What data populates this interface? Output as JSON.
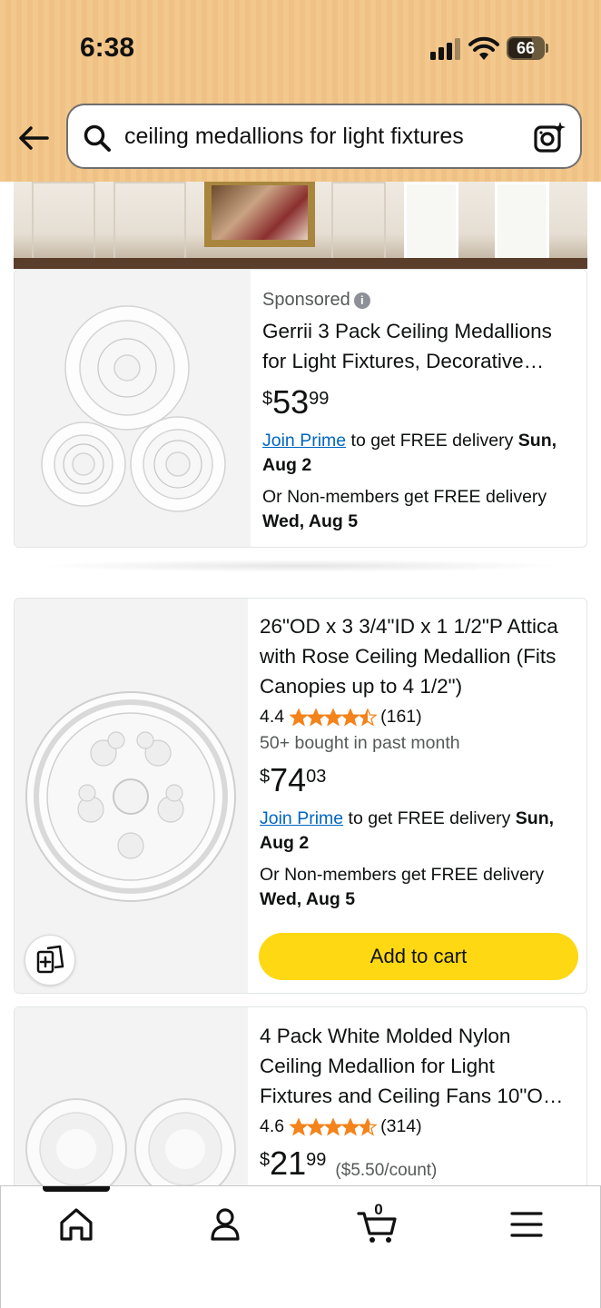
{
  "status_bar": {
    "time": "6:38",
    "battery": "66"
  },
  "search": {
    "query": "ceiling medallions for light fixtures"
  },
  "products": [
    {
      "sponsored": "Sponsored",
      "title_line1": "Gerrii 3 Pack Ceiling Medallions",
      "title_line2": "for Light Fixtures, Decorative…",
      "price_symbol": "$",
      "price_whole": "53",
      "price_fraction": "99",
      "join_prime": "Join Prime",
      "prime_text": " to get FREE delivery ",
      "prime_date1": "Sun,",
      "prime_date2": "Aug 2",
      "non_members": "Or Non-members get FREE delivery",
      "non_members_date": "Wed, Aug 5"
    },
    {
      "title_line1": "26\"OD x 3 3/4\"ID x 1 1/2\"P Attica",
      "title_line2": "with Rose Ceiling Medallion (Fits",
      "title_line3": "Canopies up to 4 1/2\")",
      "rating": "4.4",
      "stars": 4.4,
      "review_count": "(161)",
      "bought": "50+ bought in past month",
      "price_symbol": "$",
      "price_whole": "74",
      "price_fraction": "03",
      "join_prime": "Join Prime",
      "prime_text": " to get FREE delivery ",
      "prime_date1": "Sun,",
      "prime_date2": "Aug 2",
      "non_members": "Or Non-members get FREE delivery",
      "non_members_date": "Wed, Aug 5",
      "add_to_cart": "Add to cart"
    },
    {
      "title_line1": "4 Pack White Molded Nylon",
      "title_line2": "Ceiling Medallion for Light",
      "title_line3": "Fixtures and Ceiling Fans 10\"O…",
      "rating": "4.6",
      "stars": 4.6,
      "review_count": "(314)",
      "price_symbol": "$",
      "price_whole": "21",
      "price_fraction": "99",
      "unit_price": "($5.50/count)"
    }
  ],
  "bottom_nav": {
    "cart_count": "0"
  },
  "colors": {
    "accent_yellow": "#ffd814",
    "link_blue": "#0066c0",
    "star_orange": "#f3831a",
    "header_bg": "#f3c88d"
  },
  "icons": [
    "back-arrow-icon",
    "search-icon",
    "camera-icon",
    "info-icon",
    "compare-icon",
    "home-icon",
    "account-icon",
    "cart-icon",
    "menu-icon"
  ]
}
